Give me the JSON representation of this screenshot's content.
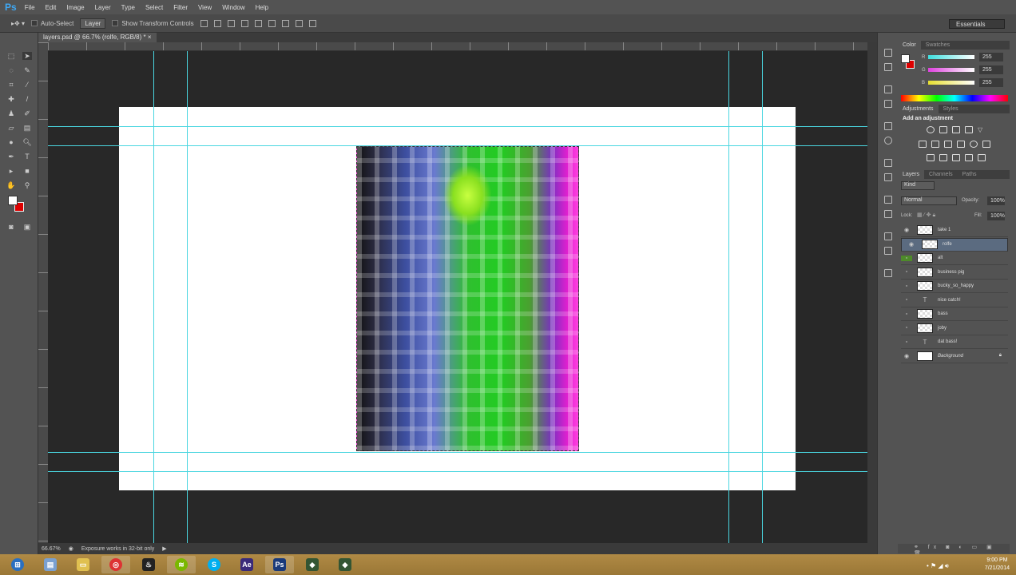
{
  "app": {
    "logo": "Ps",
    "menu": [
      "File",
      "Edit",
      "Image",
      "Layer",
      "Type",
      "Select",
      "Filter",
      "View",
      "Window",
      "Help"
    ]
  },
  "options": {
    "auto_select": "Auto-Select",
    "auto_select_target": "Layer",
    "show_transform": "Show Transform Controls",
    "workspace": "Essentials"
  },
  "document": {
    "tab": "layers.psd @ 66.7% (rolfe, RGB/8) *"
  },
  "status": {
    "zoom": "66.67%",
    "message": "Exposure works in 32-bit only"
  },
  "color_panel": {
    "tabs": [
      "Color",
      "Swatches"
    ],
    "channels": [
      {
        "label": "R",
        "value": "255",
        "color": "#3ee0e0"
      },
      {
        "label": "G",
        "value": "255",
        "color": "#e040e0"
      },
      {
        "label": "B",
        "value": "255",
        "color": "#e8e030"
      }
    ],
    "foreground": "#ffffff",
    "background": "#dd0000"
  },
  "adjustments_panel": {
    "tabs": [
      "Adjustments",
      "Styles"
    ],
    "title": "Add an adjustment"
  },
  "layers_panel": {
    "tabs": [
      "Layers",
      "Channels",
      "Paths"
    ],
    "filter": "Kind",
    "blend_mode": "Normal",
    "opacity_label": "Opacity:",
    "opacity": "100%",
    "lock_label": "Lock:",
    "fill_label": "Fill:",
    "fill": "100%",
    "layers": [
      {
        "name": "take 1",
        "visible": true,
        "type": "image",
        "selected": false
      },
      {
        "name": "rolfe",
        "visible": true,
        "type": "image",
        "selected": true
      },
      {
        "name": "alt",
        "visible": false,
        "type": "image",
        "selected": false
      },
      {
        "name": "business pig",
        "visible": false,
        "type": "image",
        "selected": false
      },
      {
        "name": "bucky_so_happy",
        "visible": false,
        "type": "image",
        "selected": false
      },
      {
        "name": "nice catch!",
        "visible": false,
        "type": "text",
        "selected": false
      },
      {
        "name": "bass",
        "visible": false,
        "type": "image",
        "selected": false
      },
      {
        "name": "joby",
        "visible": false,
        "type": "image",
        "selected": false
      },
      {
        "name": "dat bass!",
        "visible": false,
        "type": "text",
        "selected": false
      },
      {
        "name": "Background",
        "visible": true,
        "type": "image",
        "selected": false
      }
    ]
  },
  "taskbar": {
    "apps": [
      "start",
      "file-explorer-doc",
      "libraries",
      "chrome",
      "steam",
      "spotify",
      "skype",
      "Ae",
      "Ps",
      "app-green",
      "app-green-2"
    ],
    "time": "9:00 PM",
    "date": "7/21/2014"
  }
}
